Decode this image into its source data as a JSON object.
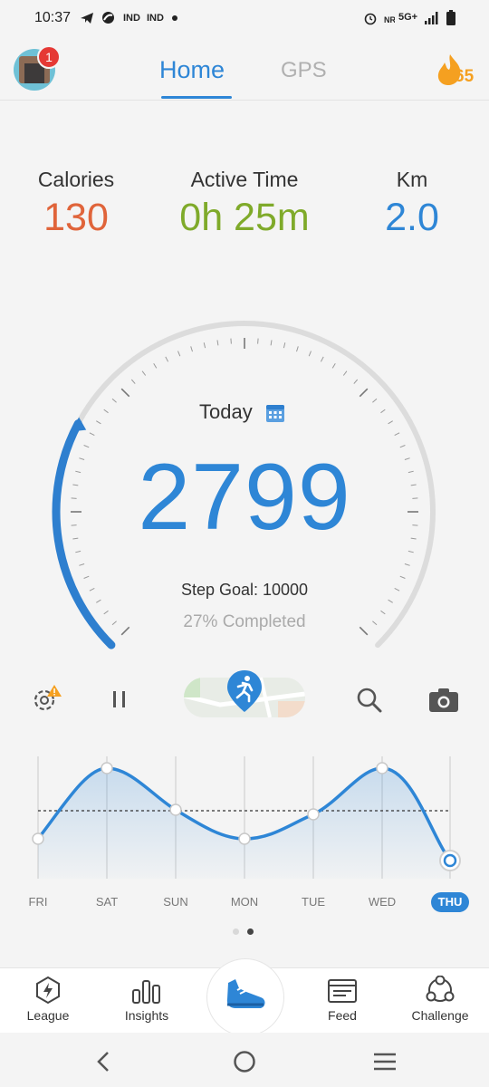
{
  "status": {
    "time": "10:37",
    "carrier1": "IND",
    "carrier2": "IND",
    "network": "5G+"
  },
  "header": {
    "tab_home": "Home",
    "tab_gps": "GPS",
    "avatar_badge": "1",
    "streak": "65"
  },
  "stats": {
    "calories_label": "Calories",
    "calories_value": "130",
    "active_label": "Active Time",
    "active_value": "0h 25m",
    "km_label": "Km",
    "km_value": "2.0"
  },
  "dial": {
    "today_label": "Today",
    "steps": "2799",
    "goal_text": "Step Goal: 10000",
    "completed_text": "27% Completed",
    "progress": 0.27
  },
  "week": {
    "days": [
      "FRI",
      "SAT",
      "SUN",
      "MON",
      "TUE",
      "WED",
      "THU"
    ],
    "selected": "THU"
  },
  "nav": {
    "league": "League",
    "insights": "Insights",
    "feed": "Feed",
    "challenge": "Challenge"
  },
  "colors": {
    "accent": "#2e86d6",
    "calories": "#e0643a",
    "active": "#7faa2a",
    "streak": "#f5a020"
  }
}
